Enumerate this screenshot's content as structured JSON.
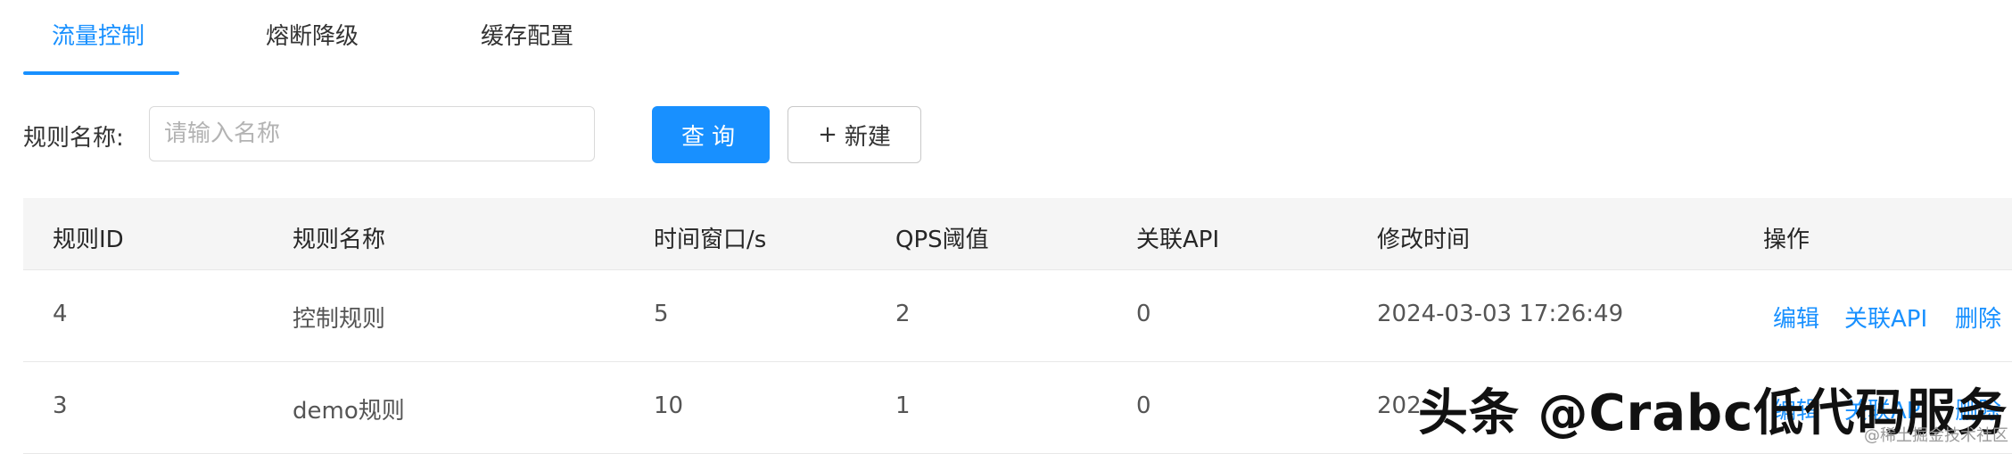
{
  "tabs": [
    {
      "label": "流量控制",
      "active": true
    },
    {
      "label": "熔断降级",
      "active": false
    },
    {
      "label": "缓存配置",
      "active": false
    }
  ],
  "search": {
    "label": "规则名称:",
    "placeholder": "请输入名称",
    "value": "",
    "query_button": "查询",
    "new_button_icon": "+",
    "new_button_label": "新建"
  },
  "table": {
    "columns": [
      "规则ID",
      "规则名称",
      "时间窗口/s",
      "QPS阈值",
      "关联API",
      "修改时间",
      "操作"
    ],
    "rows": [
      {
        "id": "4",
        "name": "控制规则",
        "window": "5",
        "qps": "2",
        "api": "0",
        "modified": "2024-03-03 17:26:49",
        "actions": [
          "编辑",
          "关联API",
          "删除"
        ]
      },
      {
        "id": "3",
        "name": "demo规则",
        "window": "10",
        "qps": "1",
        "api": "0",
        "modified": "202",
        "actions": [
          "编辑",
          "关联API",
          "删除"
        ]
      }
    ]
  },
  "watermark": {
    "main": "头条 @Crabc低代码服务",
    "sub": "@稀土掘金技术社区"
  },
  "colors": {
    "accent": "#1890ff",
    "header_bg": "#f5f5f5",
    "border": "#e8e8e8"
  }
}
